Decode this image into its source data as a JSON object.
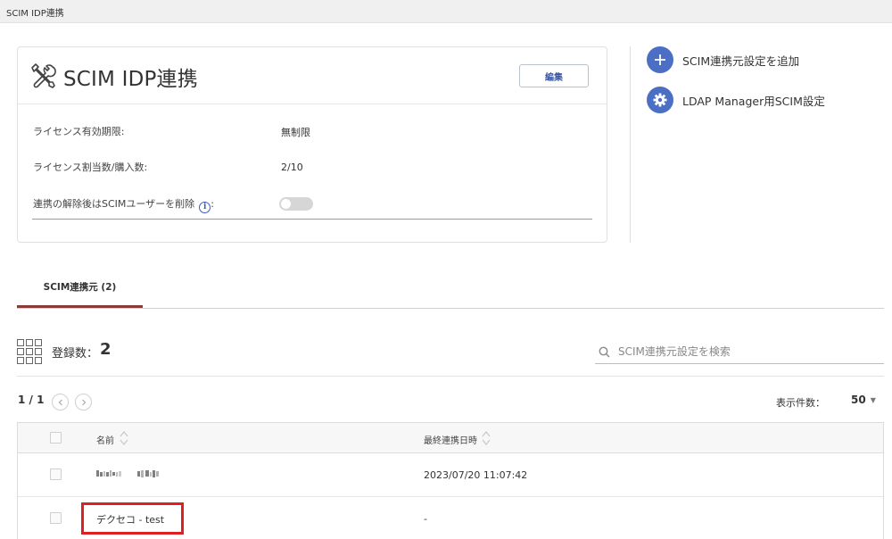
{
  "window": {
    "title": "SCIM IDP連携"
  },
  "card": {
    "title": "SCIM IDP連携",
    "edit_label": "編集",
    "rows": [
      {
        "label": "ライセンス有効期限:",
        "value": "無制限"
      },
      {
        "label": "ライセンス割当数/購入数:",
        "value": "2/10"
      },
      {
        "label": "連携の解除後はSCIMユーザーを削除",
        "suffix": ":"
      }
    ],
    "toggle_on": false
  },
  "actions": [
    {
      "label": "SCIM連携元設定を追加",
      "icon": "plus-icon"
    },
    {
      "label": "LDAP Manager用SCIM設定",
      "icon": "gear-icon"
    }
  ],
  "tabs": [
    {
      "label": "SCIM連携元 (2)",
      "active": true
    }
  ],
  "registration": {
    "label": "登録数：",
    "count": "2"
  },
  "search": {
    "placeholder": "SCIM連携元設定を検索"
  },
  "pager": {
    "page": "1 / 1"
  },
  "per_page": {
    "label": "表示件数：",
    "value": "50"
  },
  "table": {
    "columns": [
      "名前",
      "最終連携日時"
    ],
    "rows": [
      {
        "name": "",
        "last_sync": "2023/07/20 11:07:42"
      },
      {
        "name": "デクセコ - test",
        "last_sync": "-"
      }
    ]
  },
  "colors": {
    "accent": "#4a6fc4",
    "tab_underline": "#8b3a3a",
    "highlight": "#e02020"
  }
}
